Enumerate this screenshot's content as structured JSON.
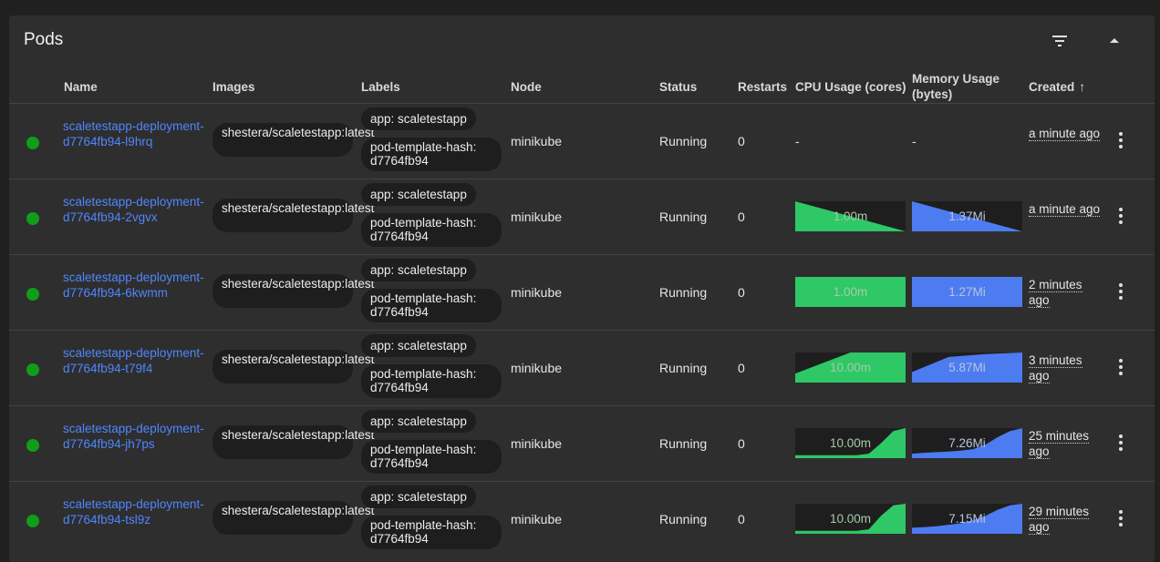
{
  "card": {
    "title": "Pods"
  },
  "columns": {
    "name": "Name",
    "images": "Images",
    "labels": "Labels",
    "node": "Node",
    "status": "Status",
    "restarts": "Restarts",
    "cpu": "CPU Usage (cores)",
    "memory_line1": "Memory Usage",
    "memory_line2": "(bytes)",
    "created": "Created"
  },
  "colors": {
    "running": "#109e1a",
    "cpu": "#2ec866",
    "memory": "#4d7cf0",
    "link": "#4f86ff"
  },
  "pods": [
    {
      "name": "scaletestapp-deployment-d7764fb94-l9hrq",
      "image": "shestera/scaletestapp:latest",
      "label_app": "app: scaletestapp",
      "label_hash": "pod-template-hash: d7764fb94",
      "node": "minikube",
      "status": "Running",
      "restarts": "0",
      "cpu": "-",
      "memory": "-",
      "created": "a minute ago",
      "has_metrics": false
    },
    {
      "name": "scaletestapp-deployment-d7764fb94-2vgvx",
      "image": "shestera/scaletestapp:latest",
      "label_app": "app: scaletestapp",
      "label_hash": "pod-template-hash: d7764fb94",
      "node": "minikube",
      "status": "Running",
      "restarts": "0",
      "cpu": "1.00m",
      "memory": "1.37Mi",
      "created": "a minute ago",
      "has_metrics": true,
      "cpu_trend": [
        1,
        0
      ],
      "mem_trend": [
        1,
        0
      ]
    },
    {
      "name": "scaletestapp-deployment-d7764fb94-6kwmm",
      "image": "shestera/scaletestapp:latest",
      "label_app": "app: scaletestapp",
      "label_hash": "pod-template-hash: d7764fb94",
      "node": "minikube",
      "status": "Running",
      "restarts": "0",
      "cpu": "1.00m",
      "memory": "1.27Mi",
      "created": "2 minutes ago",
      "has_metrics": true,
      "cpu_trend": [
        1,
        1
      ],
      "mem_trend": [
        1,
        1
      ]
    },
    {
      "name": "scaletestapp-deployment-d7764fb94-t79f4",
      "image": "shestera/scaletestapp:latest",
      "label_app": "app: scaletestapp",
      "label_hash": "pod-template-hash: d7764fb94",
      "node": "minikube",
      "status": "Running",
      "restarts": "0",
      "cpu": "10.00m",
      "memory": "5.87Mi",
      "created": "3 minutes ago",
      "has_metrics": true,
      "cpu_trend": [
        0.3,
        1,
        1
      ],
      "mem_trend": [
        0.35,
        0.85,
        0.95,
        1
      ]
    },
    {
      "name": "scaletestapp-deployment-d7764fb94-jh7ps",
      "image": "shestera/scaletestapp:latest",
      "label_app": "app: scaletestapp",
      "label_hash": "pod-template-hash: d7764fb94",
      "node": "minikube",
      "status": "Running",
      "restarts": "0",
      "cpu": "10.00m",
      "memory": "7.26Mi",
      "created": "25 minutes ago",
      "has_metrics": true,
      "cpu_trend": [
        0.1,
        0.1,
        0.1,
        0.1,
        0.1,
        0.1,
        0.15,
        0.5,
        0.9,
        1
      ],
      "mem_trend": [
        0.15,
        0.18,
        0.2,
        0.22,
        0.25,
        0.3,
        0.45,
        0.7,
        0.9,
        1
      ]
    },
    {
      "name": "scaletestapp-deployment-d7764fb94-tsl9z",
      "image": "shestera/scaletestapp:latest",
      "label_app": "app: scaletestapp",
      "label_hash": "pod-template-hash: d7764fb94",
      "node": "minikube",
      "status": "Running",
      "restarts": "0",
      "cpu": "10.00m",
      "memory": "7.15Mi",
      "created": "29 minutes ago",
      "has_metrics": true,
      "cpu_trend": [
        0.1,
        0.1,
        0.1,
        0.1,
        0.1,
        0.1,
        0.15,
        0.6,
        0.95,
        1
      ],
      "mem_trend": [
        0.2,
        0.22,
        0.25,
        0.3,
        0.35,
        0.45,
        0.6,
        0.8,
        0.95,
        1
      ]
    }
  ]
}
